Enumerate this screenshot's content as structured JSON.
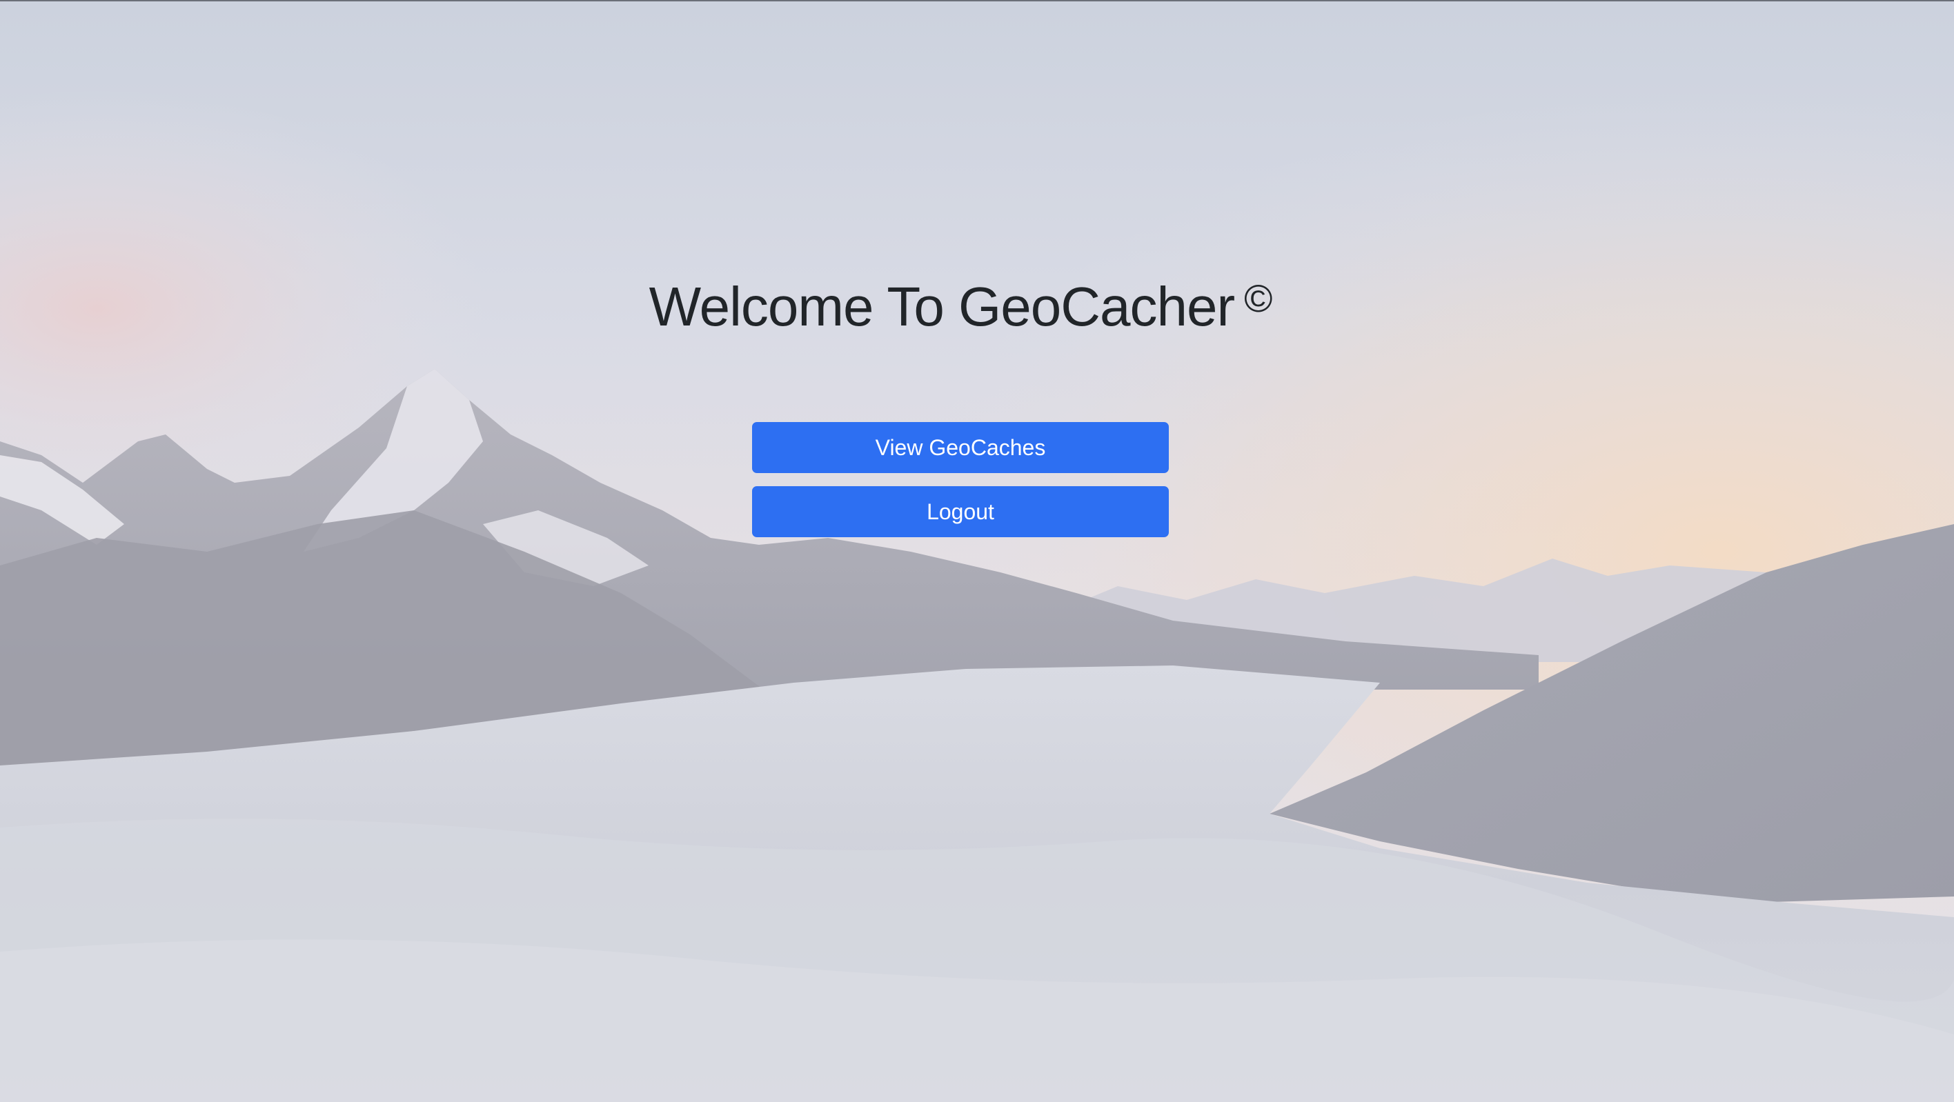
{
  "header": {
    "title": "Welcome To GeoCacher",
    "copyright_symbol": "©"
  },
  "actions": {
    "view_geocaches_label": "View GeoCaches",
    "logout_label": "Logout"
  },
  "colors": {
    "primary_button": "#2d6ff2",
    "title_text": "#212529",
    "button_text": "#ffffff"
  },
  "background": {
    "scene": "mountain-sea-of-clouds"
  }
}
